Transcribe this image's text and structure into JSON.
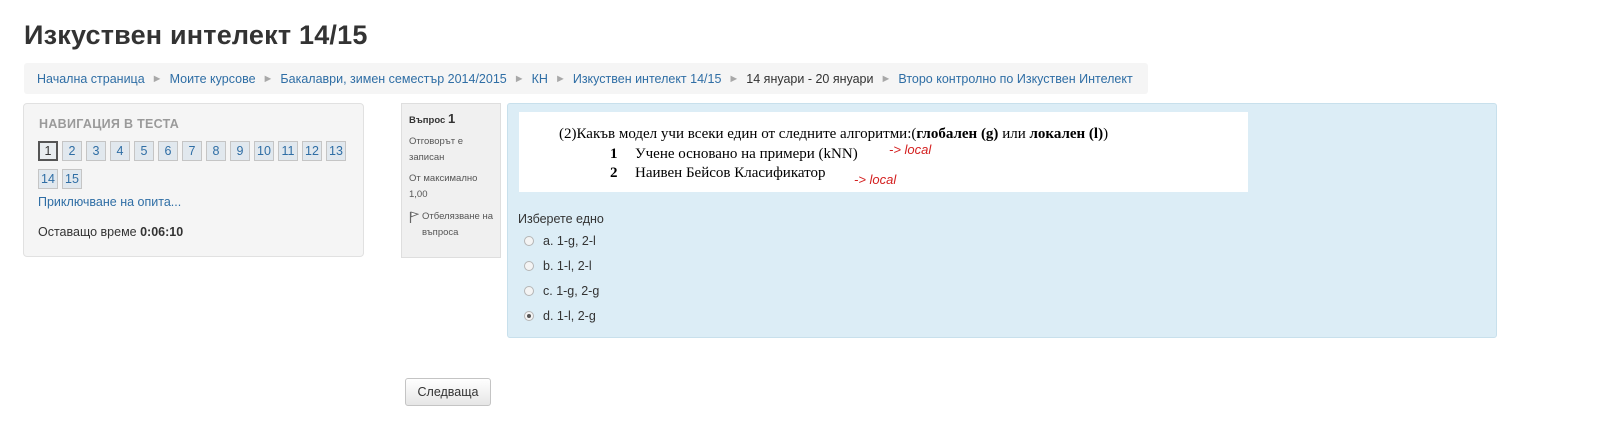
{
  "page": {
    "title": "Изкуствен интелект 14/15"
  },
  "breadcrumb": [
    {
      "label": "Начална страница",
      "link": true
    },
    {
      "label": "Моите курсове",
      "link": true
    },
    {
      "label": "Бакалаври, зимен семестър 2014/2015",
      "link": true
    },
    {
      "label": "КН",
      "link": true
    },
    {
      "label": "Изкуствен интелект 14/15",
      "link": true
    },
    {
      "label": "14 януари - 20 януари",
      "link": false
    },
    {
      "label": "Второ контролно по Изкуствен Интелект",
      "link": true
    }
  ],
  "breadcrumb_separator": "►",
  "quiz_nav": {
    "title": "НАВИГАЦИЯ В ТЕСТА",
    "questions_row1": [
      "1",
      "2",
      "3",
      "4",
      "5",
      "6",
      "7",
      "8",
      "9",
      "10",
      "11",
      "12",
      "13"
    ],
    "questions_row2": [
      "14",
      "15"
    ],
    "current": "1",
    "finish_label": "Приключване на опита...",
    "time_label": "Оставащо време",
    "time_value": "0:06:10"
  },
  "question_info": {
    "label": "Въпрос",
    "number": "1",
    "status": "Отговорът е записан",
    "max_label": "От максимално",
    "max_value": "1,00",
    "flag_label": "Отбелязване на въпроса"
  },
  "question": {
    "image_text": {
      "line1_prefix": "(2)Какъв модел учи всеки един от следните алгоритми:(",
      "line1_bold1": "глобален (g)",
      "line1_mid": " или ",
      "line1_bold2": "локален (l)",
      "line1_suffix": ")",
      "item1_idx": "1",
      "item1_text": "Учене основано на примери (kNN)",
      "item2_idx": "2",
      "item2_text": "Наивен Бейсов Класификатор",
      "annotation1": "-> local",
      "annotation2": "-> local"
    },
    "prompt": "Изберете едно",
    "options": [
      {
        "label": "a. 1-g, 2-l",
        "checked": false
      },
      {
        "label": "b. 1-l, 2-l",
        "checked": false
      },
      {
        "label": "c. 1-g, 2-g",
        "checked": false
      },
      {
        "label": "d. 1-l, 2-g",
        "checked": true
      }
    ]
  },
  "next_button": "Следваща",
  "colors": {
    "link": "#2f6ea5",
    "question_bg": "#dcedf6",
    "annotation": "#d42020"
  }
}
